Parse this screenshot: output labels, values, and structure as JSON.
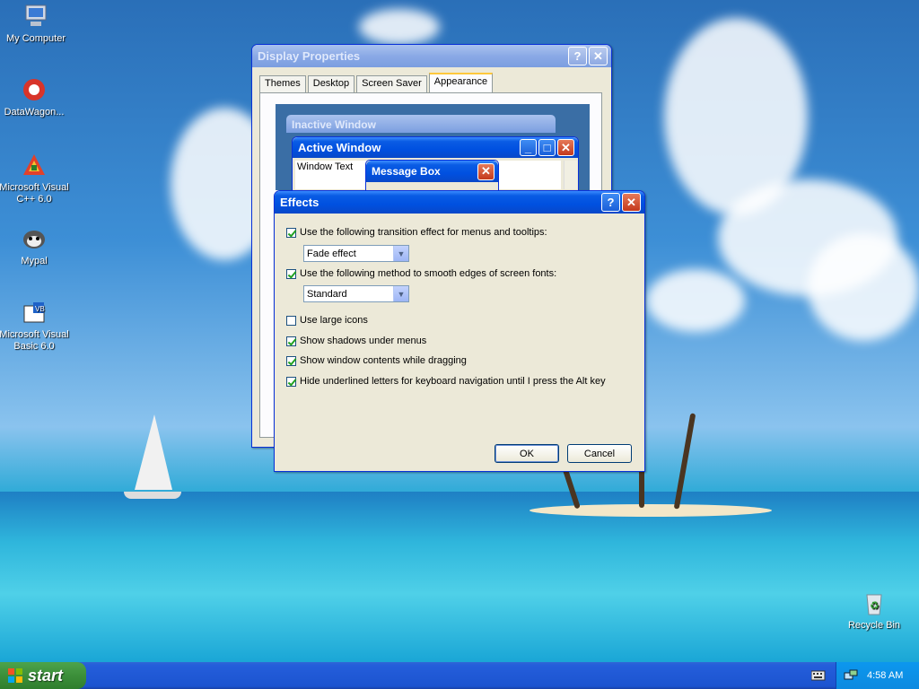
{
  "desktop": {
    "icons": [
      {
        "label": "My Computer",
        "icon": "computer-icon"
      },
      {
        "label": "DataWagon...",
        "icon": "datawagon-icon"
      },
      {
        "label": "Microsoft Visual C++ 6.0",
        "icon": "visual-cpp-icon"
      },
      {
        "label": "Mypal",
        "icon": "mypal-icon"
      },
      {
        "label": "Microsoft Visual Basic 6.0",
        "icon": "visual-basic-icon"
      },
      {
        "label": "Recycle Bin",
        "icon": "recycle-bin-icon"
      }
    ]
  },
  "display_properties": {
    "title": "Display Properties",
    "tabs": [
      "Themes",
      "Desktop",
      "Screen Saver",
      "Appearance"
    ],
    "selected_tab": "Appearance",
    "preview": {
      "inactive_title": "Inactive Window",
      "active_title": "Active Window",
      "window_text": "Window Text",
      "message_box_title": "Message Box"
    }
  },
  "effects": {
    "title": "Effects",
    "options": [
      {
        "label": "Use the following transition effect for menus and tooltips:",
        "checked": true
      },
      {
        "label": "Use the following method to smooth edges of screen fonts:",
        "checked": true
      },
      {
        "label": "Use large icons",
        "checked": false
      },
      {
        "label": "Show shadows under menus",
        "checked": true
      },
      {
        "label": "Show window contents while dragging",
        "checked": true
      },
      {
        "label": "Hide underlined letters for keyboard navigation until I press the Alt key",
        "checked": true
      }
    ],
    "transition_select": "Fade effect",
    "smoothing_select": "Standard",
    "ok_label": "OK",
    "cancel_label": "Cancel"
  },
  "taskbar": {
    "start_label": "start",
    "clock": "4:58 AM"
  },
  "colors": {
    "title_active": "#0a5ce4",
    "dialog_face": "#ece9d8",
    "start_green": "#3c8f3a"
  }
}
